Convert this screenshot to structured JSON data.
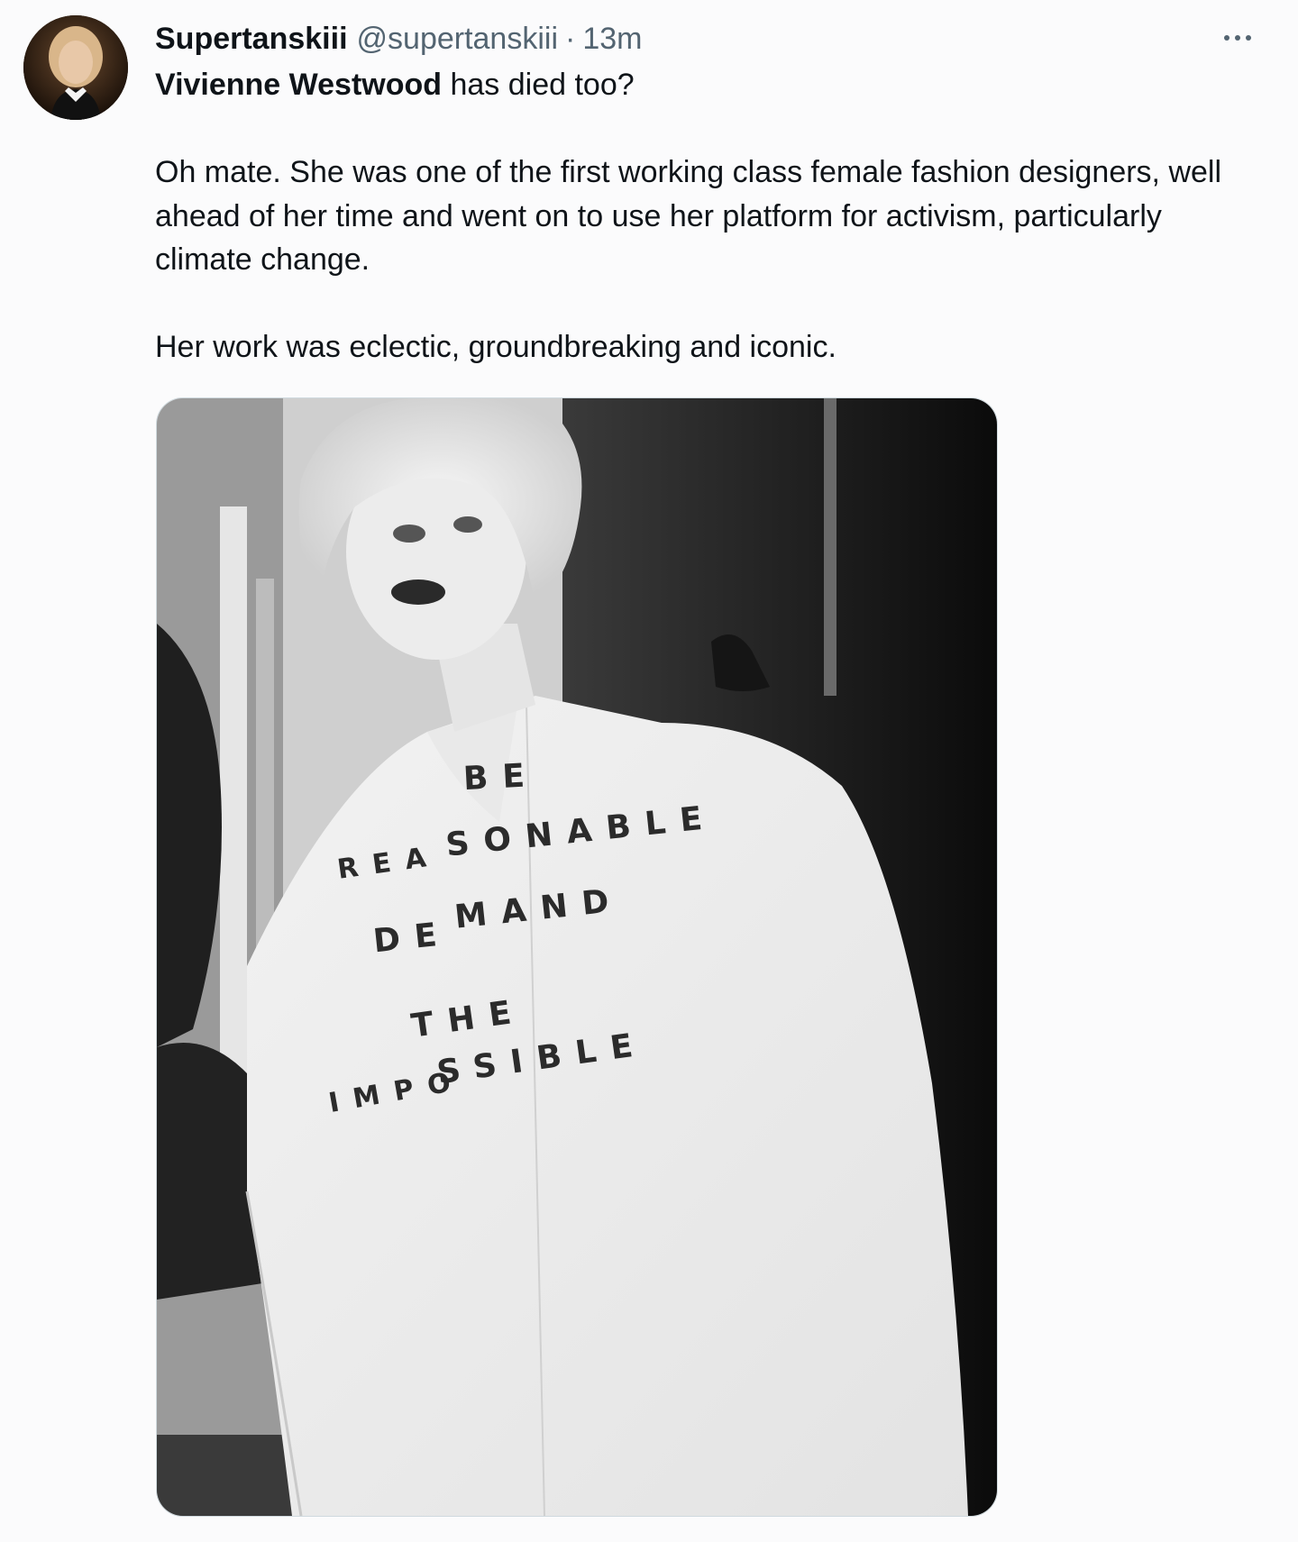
{
  "tweet": {
    "display_name": "Supertanskiii",
    "handle": "@supertanskiii",
    "separator": "·",
    "time": "13m",
    "more_icon": "more-horizontal-icon",
    "line1_bold": "Vivienne Westwood",
    "line1_rest": " has died too?",
    "para2": "Oh mate. She was one of the first working class female fashion designers, well ahead of her time and went on to use her platform for activism, particularly climate change.",
    "para3": "Her work was eclectic, groundbreaking and iconic."
  },
  "media": {
    "shirt_words": [
      "BE",
      "REA",
      "SONABLE",
      "DE",
      "MAND",
      "THE",
      "IMPO",
      "SSIBLE"
    ]
  },
  "colors": {
    "text": "#0f1419",
    "secondary": "#536471",
    "background": "#fbfbfc",
    "border": "#cfd9de"
  }
}
